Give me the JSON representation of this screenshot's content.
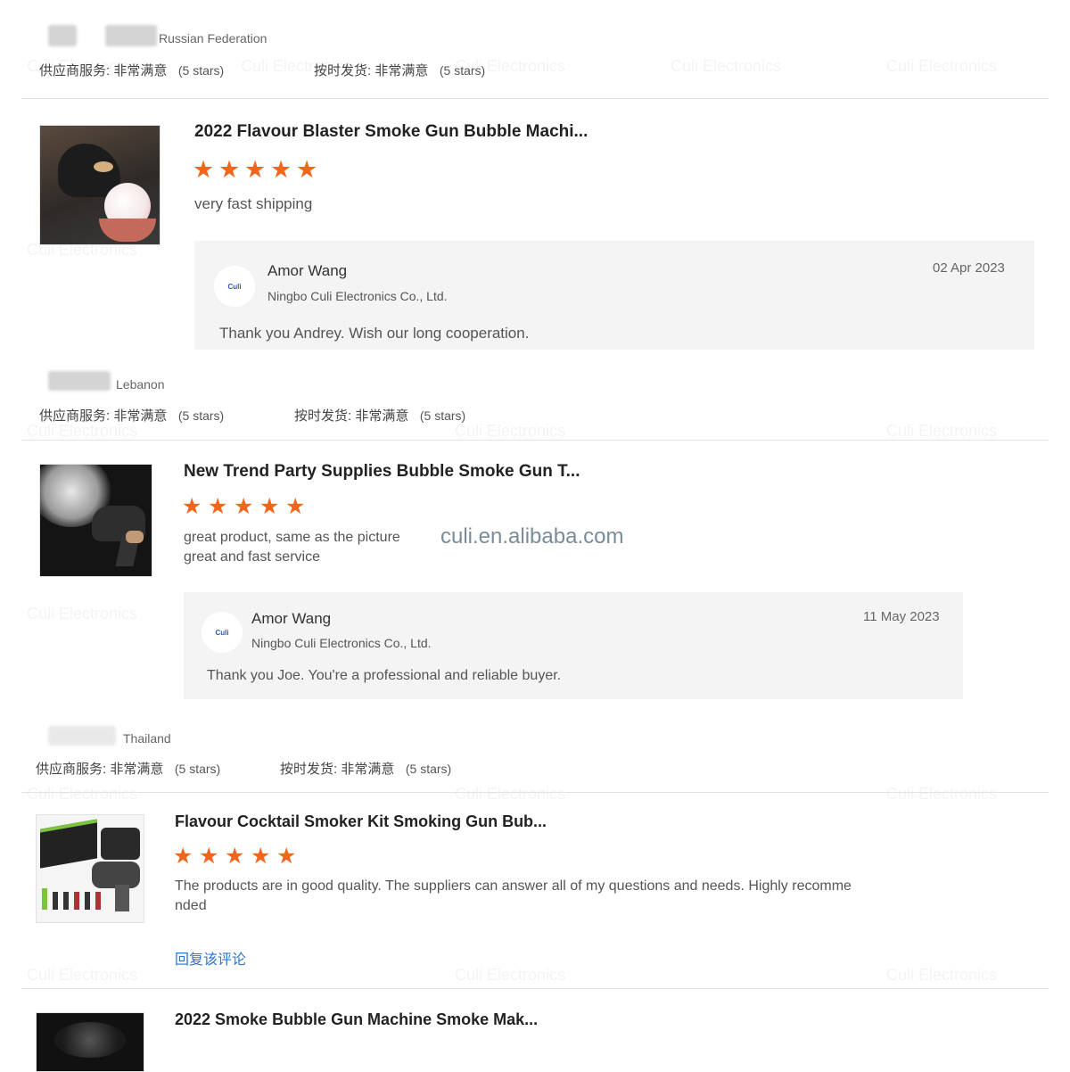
{
  "reviews": [
    {
      "country": "Russian Federation",
      "supplier_service": "供应商服务: 非常满意",
      "supplier_service_stars": "(5 stars)",
      "on_time": "按时发货: 非常满意",
      "on_time_stars": "(5 stars)",
      "product_title": "2022 Flavour Blaster Smoke Gun Bubble Machi...",
      "rating": 5,
      "review_text": "very fast shipping",
      "reply": {
        "name": "Amor Wang",
        "company": "Ningbo Culi Electronics Co., Ltd.",
        "date": "02 Apr 2023",
        "message": "Thank you Andrey. Wish our long cooperation."
      }
    },
    {
      "country": "Lebanon",
      "supplier_service": "供应商服务: 非常满意",
      "supplier_service_stars": "(5 stars)",
      "on_time": "按时发货: 非常满意",
      "on_time_stars": "(5 stars)",
      "product_title": "New Trend Party Supplies Bubble Smoke Gun T...",
      "rating": 5,
      "review_text_1": "great product, same as the picture",
      "review_text_2": "great and fast service",
      "reply": {
        "name": "Amor Wang",
        "company": "Ningbo Culi Electronics Co., Ltd.",
        "date": "11 May 2023",
        "message": "Thank you Joe. You're a professional and reliable buyer."
      }
    },
    {
      "country": "Thailand",
      "supplier_service": "供应商服务: 非常满意",
      "supplier_service_stars": "(5 stars)",
      "on_time": "按时发货: 非常满意",
      "on_time_stars": "(5 stars)",
      "product_title": "Flavour Cocktail Smoker Kit Smoking Gun Bub...",
      "rating": 5,
      "review_text_1": "The products are in good quality. The suppliers can answer all of my questions and needs. Highly recomme",
      "review_text_2": "nded",
      "reply_link": "回复该评论"
    },
    {
      "product_title": "2022 Smoke Bubble Gun Machine Smoke Mak..."
    }
  ],
  "watermark_site": "culi.en.alibaba.com",
  "watermark_brand": "Culi Electronics",
  "logo_text": "Culi",
  "star_glyph": "★",
  "colors": {
    "star": "#f2661c",
    "link": "#2d74d3",
    "reply_bg": "#f4f4f4"
  }
}
